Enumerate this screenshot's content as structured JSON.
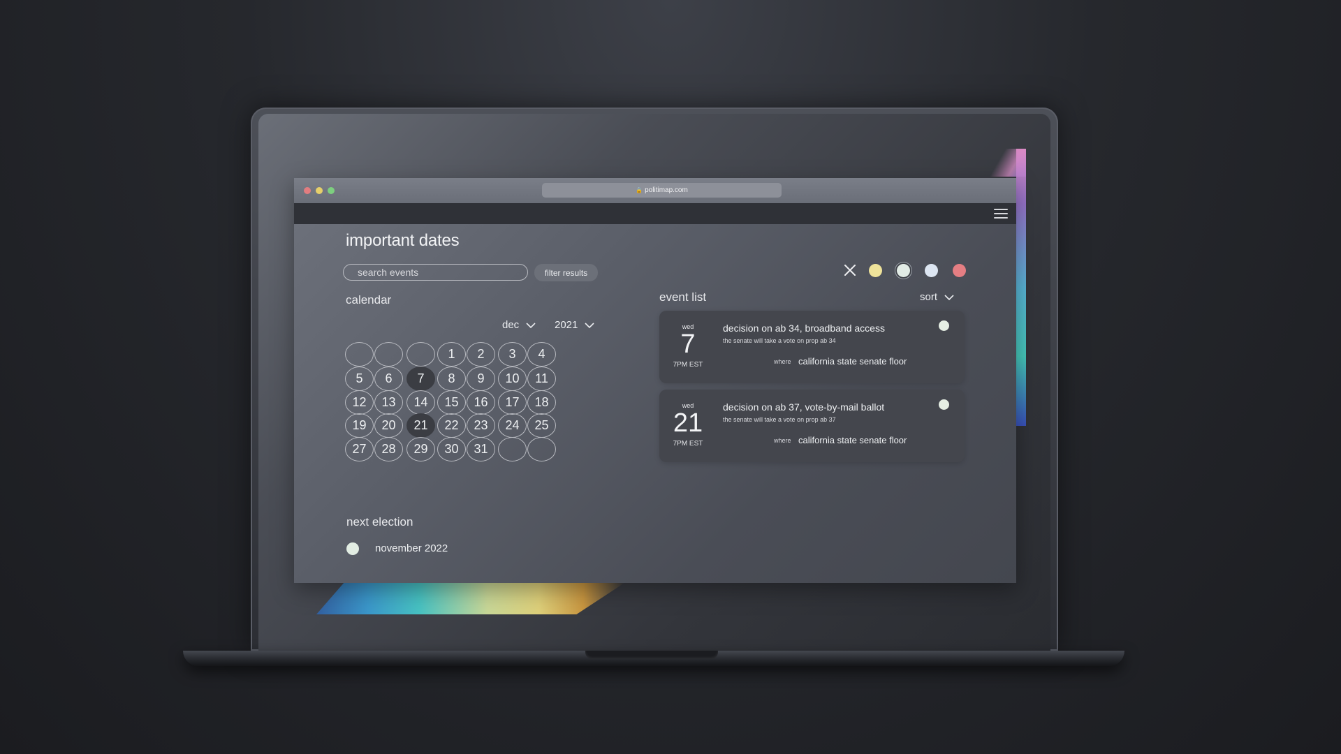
{
  "browser": {
    "url": "politimap.com"
  },
  "page": {
    "title": "important dates"
  },
  "search": {
    "placeholder": "search events",
    "filter_label": "filter results"
  },
  "filters": {
    "colors": [
      "#efe39a",
      "#e1ebe5",
      "#dde6f2",
      "#e57e83"
    ],
    "clear_icon": "close-icon"
  },
  "calendar": {
    "label": "calendar",
    "month": "dec",
    "year": "2021",
    "selected_days": [
      7,
      21
    ],
    "days": [
      "",
      "",
      "",
      "1",
      "2",
      "3",
      "4",
      "5",
      "6",
      "7",
      "8",
      "9",
      "10",
      "11",
      "12",
      "13",
      "14",
      "15",
      "16",
      "17",
      "18",
      "19",
      "20",
      "21",
      "22",
      "23",
      "24",
      "25",
      "27",
      "28",
      "29",
      "30",
      "31",
      "",
      ""
    ]
  },
  "event_list": {
    "label": "event list",
    "sort_label": "sort",
    "events": [
      {
        "day": "wed",
        "date": "7",
        "time": "7PM EST",
        "title": "decision on ab 34,  broadband access",
        "description": "the senate will take a vote on prop ab 34",
        "where_label": "where",
        "where": "california state senate floor"
      },
      {
        "day": "wed",
        "date": "21",
        "time": "7PM EST",
        "title": "decision on ab 37,  vote-by-mail ballot",
        "description": "the senate will take a vote on prop ab 37",
        "where_label": "where",
        "where": "california state senate floor"
      }
    ]
  },
  "election": {
    "label": "next election",
    "date": "november 2022"
  }
}
